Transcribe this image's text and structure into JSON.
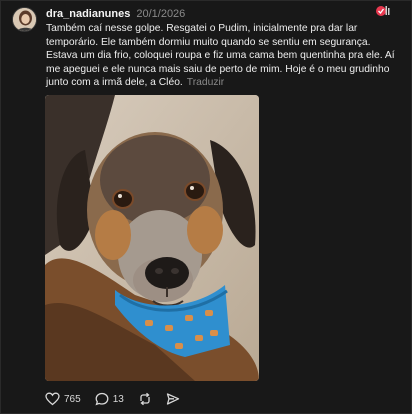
{
  "post": {
    "username": "dra_nadianunes",
    "date": "20/1/2026",
    "text": "Também caí nesse golpe. Resgatei o Pudim, inicialmente pra dar lar temporário. Ele também dormiu muito quando se sentiu em segurança. Estava um dia frio, coloquei roupa e fiz uma cama bem quentinha pra ele. Aí me apeguei e ele nunca mais saiu de perto de mim. Hoje é o meu grudinho junto com a irmã dele, a Cléo.",
    "translate_label": "Traduzir"
  },
  "actions": {
    "likes": "765",
    "replies": "13"
  },
  "icons": {
    "like": "heart-icon",
    "reply": "comment-icon",
    "repost": "repost-icon",
    "share": "send-icon",
    "top": "reaction-icon"
  },
  "colors": {
    "background": "#181818",
    "text": "#eeeeee",
    "muted": "#8a8a8a",
    "accent": "#e8384f"
  }
}
